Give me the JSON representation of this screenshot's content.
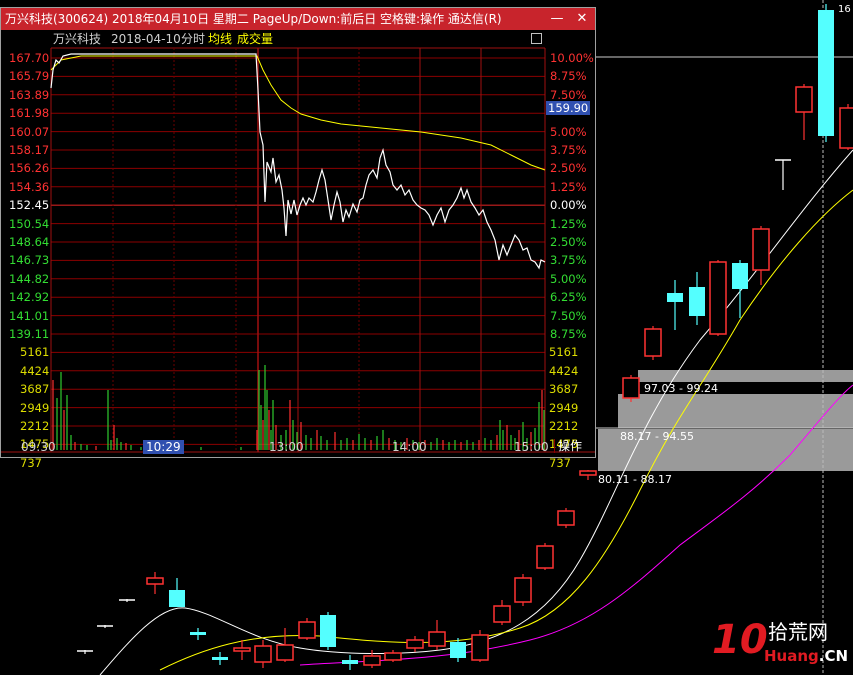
{
  "popup": {
    "title": "万兴科技(300624) 2018年04月10日 星期二 PageUp/Down:前后日 空格键:操作 通达信(R)",
    "stock_name": "万兴科技",
    "date": "2018-04-10",
    "mode": "分时",
    "indicator_avg": "均线",
    "indicator_vol": "成交量",
    "minimize_glyph": "—",
    "close_glyph": "✕",
    "operate_label": "操作",
    "cursor_time": "10:29",
    "price_tag": "159.90",
    "price_levels": [
      "167.70",
      "165.79",
      "163.89",
      "161.98",
      "160.07",
      "158.17",
      "156.26",
      "154.36",
      "152.45",
      "150.54",
      "148.64",
      "146.73",
      "144.82",
      "142.92",
      "141.01",
      "139.11"
    ],
    "pct_levels": [
      "10.00%",
      "8.75%",
      "7.50%",
      "6.25%",
      "5.00%",
      "3.75%",
      "2.50%",
      "1.25%",
      "0.00%",
      "1.25%",
      "2.50%",
      "3.75%",
      "5.00%",
      "6.25%",
      "7.50%",
      "8.75%"
    ],
    "volume_levels": [
      "5161",
      "4424",
      "3687",
      "2949",
      "2212",
      "1475",
      "737"
    ],
    "time_labels": [
      "09:30",
      "13:00",
      "14:00",
      "15:00"
    ]
  },
  "background": {
    "chip_ranges": [
      "97.03 - 99.24",
      "88.17 - 94.55",
      "80.11 - 88.17"
    ],
    "top_right_label": "16"
  },
  "watermark": {
    "logo": "10",
    "name": "拾荒网",
    "url_left": "Huang",
    "url_right": ".CN"
  },
  "colors": {
    "up": "#ff3232",
    "down": "#54ffff",
    "title_bar": "#c8242c",
    "avg_line": "#ffff00",
    "price_line": "#ffffff",
    "grid": "#8b0000"
  }
}
